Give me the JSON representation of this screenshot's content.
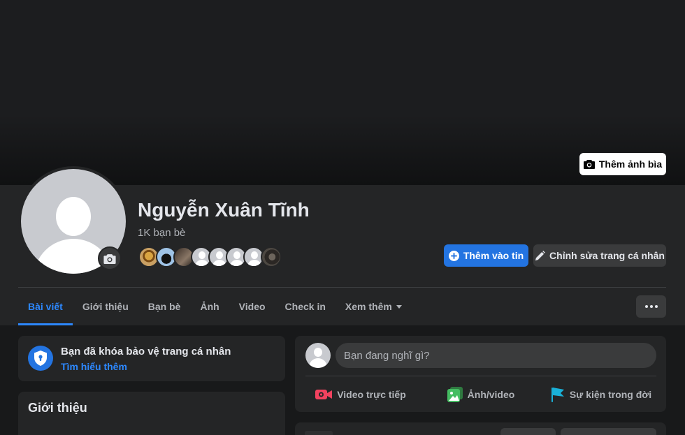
{
  "cover": {
    "add_cover_label": "Thêm ảnh bìa"
  },
  "profile": {
    "name": "Nguyễn Xuân Tĩnh",
    "friends_count": "1K bạn bè"
  },
  "actions": {
    "add_story_label": "Thêm vào tin",
    "edit_profile_label": "Chỉnh sửa trang cá nhân"
  },
  "tabs": [
    {
      "label": "Bài viết",
      "active": true
    },
    {
      "label": "Giới thiệu"
    },
    {
      "label": "Bạn bè"
    },
    {
      "label": "Ảnh"
    },
    {
      "label": "Video"
    },
    {
      "label": "Check in"
    },
    {
      "label": "Xem thêm"
    }
  ],
  "lock_notice": {
    "title": "Bạn đã khóa bảo vệ trang cá nhân",
    "link": "Tìm hiểu thêm"
  },
  "intro": {
    "title": "Giới thiệu"
  },
  "composer": {
    "placeholder": "Bạn đang nghĩ gì?",
    "actions": [
      {
        "label": "Video trực tiếp",
        "icon": "live-video-icon",
        "color": "#f3425f"
      },
      {
        "label": "Ảnh/video",
        "icon": "photo-icon",
        "color": "#45bd62"
      },
      {
        "label": "Sự kiện trong đời",
        "icon": "flag-icon",
        "color": "#1ab1d8"
      }
    ]
  },
  "colors": {
    "accent": "#2374e1",
    "link": "#2d88ff",
    "surface": "#242526",
    "background": "#18191a"
  }
}
